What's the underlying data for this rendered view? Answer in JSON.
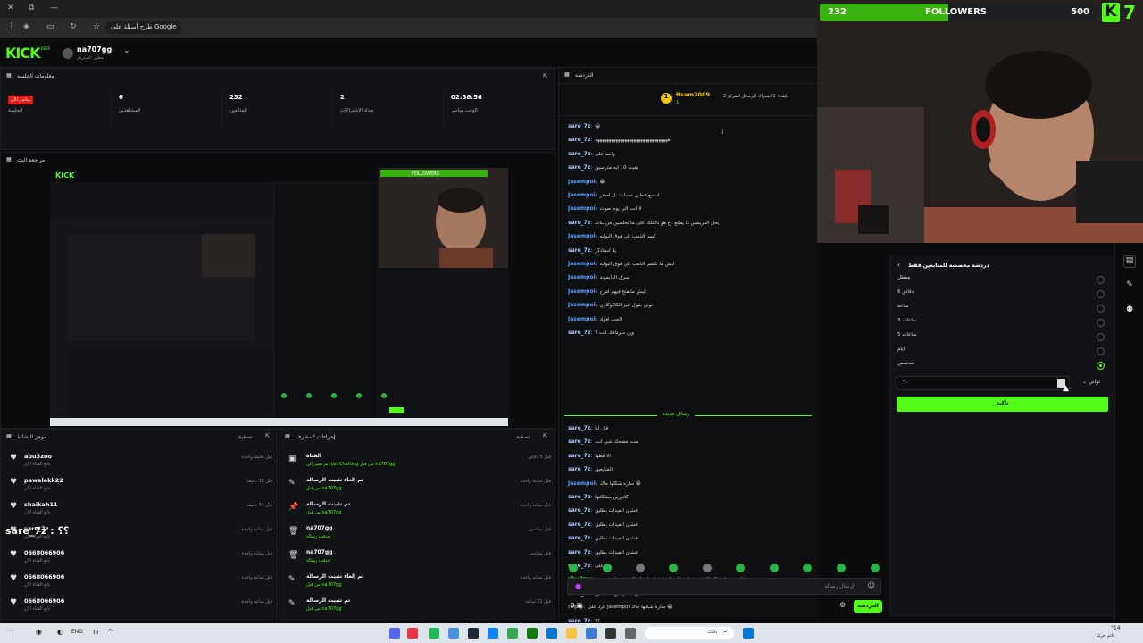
{
  "browser": {
    "search_pill": "طرح أسئلة على Google"
  },
  "kick": {
    "logo": "KICK",
    "beta": "BETA",
    "channel_name": "na707gg",
    "channel_sub": "مطور السيرفر"
  },
  "session": {
    "title": "معلومات الجلسة",
    "live_badge": "مباشر الآن",
    "live_label": "الجلسة",
    "stats": [
      {
        "value": "6",
        "label": "المشاهدين"
      },
      {
        "value": "232",
        "label": "المتابعين"
      },
      {
        "value": "2",
        "label": "تعداد الاشتراكات"
      },
      {
        "value": "02:56:56",
        "label": "الوقت مباشر"
      }
    ]
  },
  "preview": {
    "title": "مراجعة البث"
  },
  "activity": {
    "title": "موجز النشاط",
    "filter": "تصفية",
    "items": [
      {
        "user": "abu3zoo",
        "desc": "تابع القناة الآن",
        "time": "قبل دقيقة واحدة"
      },
      {
        "user": "pawelekk22",
        "desc": "تابع القناة الآن",
        "time": "قبل 38 دقيقة"
      },
      {
        "user": "shaikah11",
        "desc": "تابع القناة الآن",
        "time": "قبل 44 دقيقة"
      },
      {
        "user": "sare_7z",
        "desc": "تابع القناة الآن",
        "time": "قبل ساعة واحدة"
      },
      {
        "user": "0668066906",
        "desc": "تابع القناة الآن",
        "time": "قبل ساعة واحدة"
      },
      {
        "user": "0668066906",
        "desc": "تابع القناة الآن",
        "time": "قبل ساعة واحدة"
      },
      {
        "user": "0668066906",
        "desc": "تابع القناة الآن",
        "time": "قبل ساعة واحدة"
      }
    ]
  },
  "overlay_text": "sare_7z : ؟؟",
  "mod": {
    "title": "إجراءات المشرف",
    "filter": "تصفية",
    "items": [
      {
        "icon": "▣",
        "action": "القناة",
        "detail": "تم تغيير إلى Just Chatting من قبل na707gg",
        "time": "قبل 5 دقائق"
      },
      {
        "icon": "✎",
        "action": "تم إلغاء تثبيت الرسالة",
        "detail": "من قبل na707gg",
        "time": "قبل ساعة واحدة"
      },
      {
        "icon": "📌",
        "action": "تم تثبيت الرسالة",
        "detail": "من قبل na707gg",
        "time": "قبل ساعة واحدة"
      },
      {
        "icon": "🗑",
        "action": "na707gg",
        "detail": "حذفت رسالة",
        "time": "قبل ساعتين"
      },
      {
        "icon": "🗑",
        "action": "na707gg",
        "detail": "حذفت رسالة",
        "time": "قبل ساعتين"
      },
      {
        "icon": "✎",
        "action": "تم إلغاء تثبيت الرسالة",
        "detail": "من قبل na707gg",
        "time": "قبل ساعة واحدة"
      },
      {
        "icon": "✎",
        "action": "تم تثبيت الرسالة",
        "detail": "من قبل na707gg",
        "time": "قبل 21 ساعة"
      }
    ]
  },
  "chat": {
    "title": "الدردشة",
    "pinned_user": "Bsam2009",
    "pinned_count": "1",
    "pinned_text": "بإهداء 1 اشتراك الرسائل للمركز 2",
    "new_messages": "رسائل جديدة",
    "messages": [
      {
        "user": "sare_7z",
        "color": "#a9c6ff",
        "text": "😀"
      },
      {
        "user": "sare_7z",
        "color": "#a9c6ff",
        "text": "ههههههههههههههههههههههههههههههههه"
      },
      {
        "user": "sare_7z",
        "color": "#a9c6ff",
        "text": "وانت على"
      },
      {
        "user": "sare_7z",
        "color": "#a9c6ff",
        "text": "بقيت 10 ايه مدرسين"
      },
      {
        "user": "Jasempoi",
        "color": "#5aa0ff",
        "text": "😁"
      },
      {
        "user": "Jasempoi",
        "color": "#5aa0ff",
        "text": "اسمع عطني حسابك بل اصغر"
      },
      {
        "user": "Jasempoi",
        "color": "#5aa0ff",
        "text": "لا انت الي يوم صوت"
      },
      {
        "user": "sare_7z",
        "color": "#a9c6ff",
        "text": "يحل الفريمس دا يطلع دخ هو بالكلك على ما تخلصين من بنات"
      },
      {
        "user": "Jasempoi",
        "color": "#5aa0ff",
        "text": "كسر الذهب الي فوق البوابه"
      },
      {
        "user": "sare_7z",
        "color": "#a9c6ff",
        "text": "يلا استاذكر"
      },
      {
        "user": "Jasempoi",
        "color": "#5aa0ff",
        "text": "ليش ما تكسر الذهب الي فوق البوابه"
      },
      {
        "user": "Jasempoi",
        "color": "#5aa0ff",
        "text": "اسرق الدايموند"
      },
      {
        "user": "Jasempoi",
        "color": "#5aa0ff",
        "text": "ليش ماتفتح فيهم امزح"
      },
      {
        "user": "Jasempoi",
        "color": "#5aa0ff",
        "text": "توني بقول عيز الكاكوكاري"
      },
      {
        "user": "Jasempoi",
        "color": "#5aa0ff",
        "text": "الحب افواد"
      },
      {
        "user": "sare_7z",
        "color": "#a9c6ff",
        "text": "وين سرداقك انت ؟"
      },
      {
        "user": "sare_7z",
        "color": "#a9c6ff",
        "text": "قال لنا"
      },
      {
        "user": "sare_7z",
        "color": "#a9c6ff",
        "text": "منت مضحك شي انت"
      },
      {
        "user": "sare_7z",
        "color": "#a9c6ff",
        "text": "الا قطها"
      },
      {
        "user": "sare_7z",
        "color": "#a9c6ff",
        "text": "المتابعين"
      },
      {
        "user": "Jasempoi",
        "color": "#5aa0ff",
        "text": "ساره شكلها جاك 😁"
      },
      {
        "user": "sare_7z",
        "color": "#a9c6ff",
        "text": "كاتورين مشكلتها"
      },
      {
        "user": "sare_7z",
        "color": "#a9c6ff",
        "text": "عشان الفيدات بطلين"
      },
      {
        "user": "sare_7z",
        "color": "#a9c6ff",
        "text": "عشان الفيدات بطلين"
      },
      {
        "user": "sare_7z",
        "color": "#a9c6ff",
        "text": "عشان الفيدات بطلين"
      },
      {
        "user": "sare_7z",
        "color": "#a9c6ff",
        "text": "عشان الفيدات بطلين"
      },
      {
        "user": "sare_7z",
        "color": "#a9c6ff",
        "text": "يلالا على"
      },
      {
        "user": "abu3zoo",
        "color": "#53fc18",
        "text": "عشا من منتاح ولك الا شقت واحد لازم احط فواتو احط ولك ف حط صحيحة"
      },
      {
        "user": "sare_7z",
        "color": "#a9c6ff",
        "text": "من متشركين المتابعين"
      },
      {
        "user": "reply",
        "color": "#888888",
        "text": "الرد على Jasempoi ساره شكلها جاك 😁"
      },
      {
        "user": "sare_7z",
        "color": "#a9c6ff",
        "text": "؟؟"
      }
    ],
    "input_placeholder": "إرسال رسالة",
    "send_label": "الدردشة",
    "viewer_count": "0"
  },
  "followers_bar": {
    "current": "232",
    "label": "FOLLOWERS",
    "goal": "500",
    "progress": 0.464,
    "count_badge": "7",
    "brand_color": "#53fc18"
  },
  "settings": {
    "title": "دردشة مخصصة للمتابعين فقط",
    "options": [
      {
        "label": "معطل",
        "checked": false
      },
      {
        "label": "6 دقائق",
        "checked": false
      },
      {
        "label": "ساعة",
        "checked": false
      },
      {
        "label": "3 ساعات",
        "checked": false
      },
      {
        "label": "5 ساعات",
        "checked": false
      },
      {
        "label": "ايام",
        "checked": false
      },
      {
        "label": "مخصص",
        "checked": true
      }
    ],
    "custom_value": "٦٠",
    "unit": "ثواني",
    "confirm": "تأكيد"
  },
  "taskbar": {
    "lang": "ENG",
    "search": "بحث",
    "weather": "°14",
    "weather_sub": "غائم جزئيًا"
  }
}
